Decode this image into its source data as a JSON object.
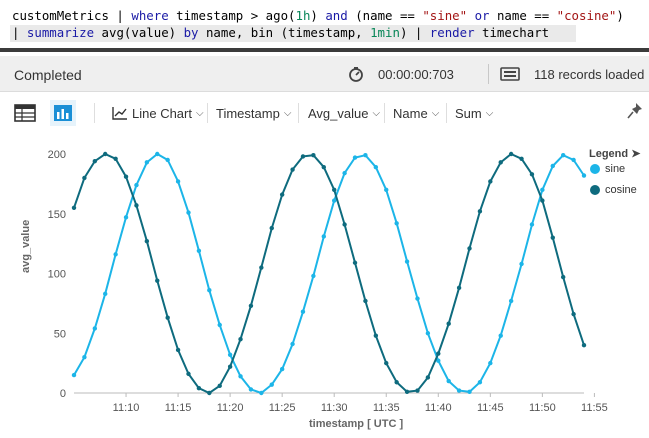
{
  "query": {
    "line1": [
      {
        "t": "customMetrics | ",
        "c": ""
      },
      {
        "t": "where",
        "c": "kw"
      },
      {
        "t": " timestamp > ago(",
        "c": ""
      },
      {
        "t": "1h",
        "c": "num"
      },
      {
        "t": ") ",
        "c": ""
      },
      {
        "t": "and",
        "c": "kw"
      },
      {
        "t": " (name == ",
        "c": ""
      },
      {
        "t": "\"sine\"",
        "c": "str"
      },
      {
        "t": " ",
        "c": ""
      },
      {
        "t": "or",
        "c": "kw"
      },
      {
        "t": " name == ",
        "c": ""
      },
      {
        "t": "\"cosine\"",
        "c": "str"
      },
      {
        "t": ")",
        "c": ""
      }
    ],
    "line2": [
      {
        "t": "| ",
        "c": ""
      },
      {
        "t": "summarize",
        "c": "kw"
      },
      {
        "t": " avg(value) ",
        "c": ""
      },
      {
        "t": "by",
        "c": "kw"
      },
      {
        "t": " name, bin (timestamp, ",
        "c": ""
      },
      {
        "t": "1min",
        "c": "num"
      },
      {
        "t": ") | ",
        "c": ""
      },
      {
        "t": "render",
        "c": "kw"
      },
      {
        "t": " timechart",
        "c": ""
      }
    ]
  },
  "status": {
    "state": "Completed",
    "duration": "00:00:00:703",
    "records": "118 records loaded"
  },
  "toolbar": {
    "chart_type": "Line Chart",
    "x_column": "Timestamp",
    "y_column": "Avg_value",
    "split_by": "Name",
    "aggregation": "Sum"
  },
  "colors": {
    "sine": "#1cb5e8",
    "cosine": "#0e6b7e",
    "accent": "#1a8fd6"
  },
  "chart_data": {
    "type": "line",
    "xlabel": "timestamp [ UTC ]",
    "ylabel": "avg_value",
    "ylim": [
      0,
      200
    ],
    "yticks": [
      0,
      50,
      100,
      150,
      200
    ],
    "xticks": [
      "11:10",
      "11:15",
      "11:20",
      "11:25",
      "11:30",
      "11:35",
      "11:40",
      "11:45",
      "11:50",
      "11:55"
    ],
    "x_start": "11:05",
    "x_step_minutes": 1,
    "legend_title": "Legend",
    "legend_position": "top-right",
    "grid": false,
    "series": [
      {
        "name": "sine",
        "color": "#1cb5e8",
        "values": [
          15,
          30,
          54,
          83,
          116,
          147,
          174,
          193,
          200,
          195,
          177,
          151,
          119,
          86,
          57,
          32,
          14,
          3,
          0,
          7,
          20,
          41,
          68,
          98,
          131,
          161,
          184,
          197,
          199,
          189,
          170,
          142,
          110,
          79,
          50,
          27,
          10,
          2,
          1,
          9,
          25,
          48,
          77,
          108,
          141,
          170,
          190,
          199,
          195,
          182
        ]
      },
      {
        "name": "cosine",
        "color": "#0e6b7e",
        "values": [
          155,
          180,
          194,
          200,
          196,
          181,
          157,
          127,
          94,
          63,
          36,
          16,
          4,
          0,
          6,
          22,
          45,
          73,
          105,
          138,
          166,
          187,
          198,
          199,
          189,
          170,
          141,
          109,
          77,
          48,
          25,
          9,
          1,
          2,
          13,
          33,
          58,
          88,
          121,
          152,
          177,
          193,
          200,
          196,
          183,
          161,
          130,
          97,
          66,
          40
        ]
      }
    ]
  }
}
